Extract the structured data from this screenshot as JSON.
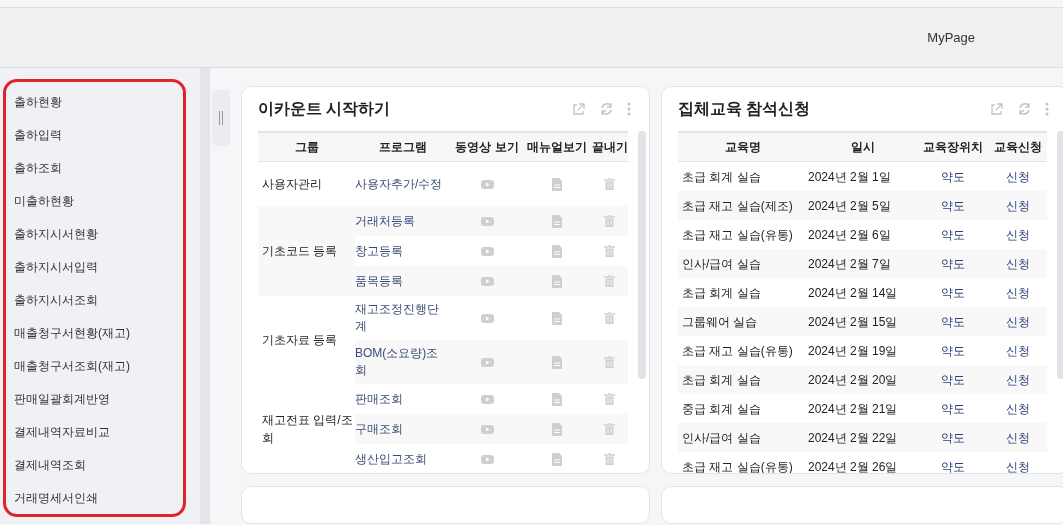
{
  "header": {
    "mypage_link": "MyPage"
  },
  "sidebar": {
    "highlighted": true,
    "items": [
      {
        "label": "출하현황"
      },
      {
        "label": "출하입력"
      },
      {
        "label": "출하조회"
      },
      {
        "label": "미출하현황"
      },
      {
        "label": "출하지시서현황"
      },
      {
        "label": "출하지시서입력"
      },
      {
        "label": "출하지시서조회"
      },
      {
        "label": "매출청구서현황(재고)"
      },
      {
        "label": "매출청구서조회(재고)"
      },
      {
        "label": "판매일괄회계반영"
      },
      {
        "label": "결제내역자료비교"
      },
      {
        "label": "결제내역조회"
      },
      {
        "label": "거래명세서인쇄"
      }
    ]
  },
  "start_card": {
    "title": "이카운트 시작하기",
    "columns": [
      "그룹",
      "프로그램",
      "동영상 보기",
      "매뉴얼보기",
      "끝내기"
    ],
    "groups": [
      {
        "name": "사용자관리",
        "programs": [
          "사용자추가/수정"
        ]
      },
      {
        "name": "기초코드 등록",
        "programs": [
          "거래처등록",
          "창고등록",
          "품목등록"
        ]
      },
      {
        "name": "기초자료 등록",
        "programs": [
          "재고조정진행단계",
          "BOM(소요량)조회"
        ]
      },
      {
        "name": "재고전표 입력/조회",
        "programs": [
          "판매조회",
          "구매조회",
          "생산입고조회"
        ]
      }
    ]
  },
  "training_card": {
    "title": "집체교육 참석신청",
    "columns": [
      "교육명",
      "일시",
      "교육장위치",
      "교육신청"
    ],
    "rows": [
      {
        "name": "초급 회계 실습",
        "date": "2024년 2월 1일",
        "location": "약도",
        "apply": "신청"
      },
      {
        "name": "초급 재고 실습(제조)",
        "date": "2024년 2월 5일",
        "location": "약도",
        "apply": "신청"
      },
      {
        "name": "초급 재고 실습(유통)",
        "date": "2024년 2월 6일",
        "location": "약도",
        "apply": "신청"
      },
      {
        "name": "인사/급여 실습",
        "date": "2024년 2월 7일",
        "location": "약도",
        "apply": "신청"
      },
      {
        "name": "초급 회계 실습",
        "date": "2024년 2월 14일",
        "location": "약도",
        "apply": "신청"
      },
      {
        "name": "그룹웨어 실습",
        "date": "2024년 2월 15일",
        "location": "약도",
        "apply": "신청"
      },
      {
        "name": "초급 재고 실습(유통)",
        "date": "2024년 2월 19일",
        "location": "약도",
        "apply": "신청"
      },
      {
        "name": "초급 회계 실습",
        "date": "2024년 2월 20일",
        "location": "약도",
        "apply": "신청"
      },
      {
        "name": "중급 회계 실습",
        "date": "2024년 2월 21일",
        "location": "약도",
        "apply": "신청"
      },
      {
        "name": "인사/급여 실습",
        "date": "2024년 2월 22일",
        "location": "약도",
        "apply": "신청"
      },
      {
        "name": "초급 재고 실습(유통)",
        "date": "2024년 2월 26일",
        "location": "약도",
        "apply": "신청"
      }
    ]
  }
}
